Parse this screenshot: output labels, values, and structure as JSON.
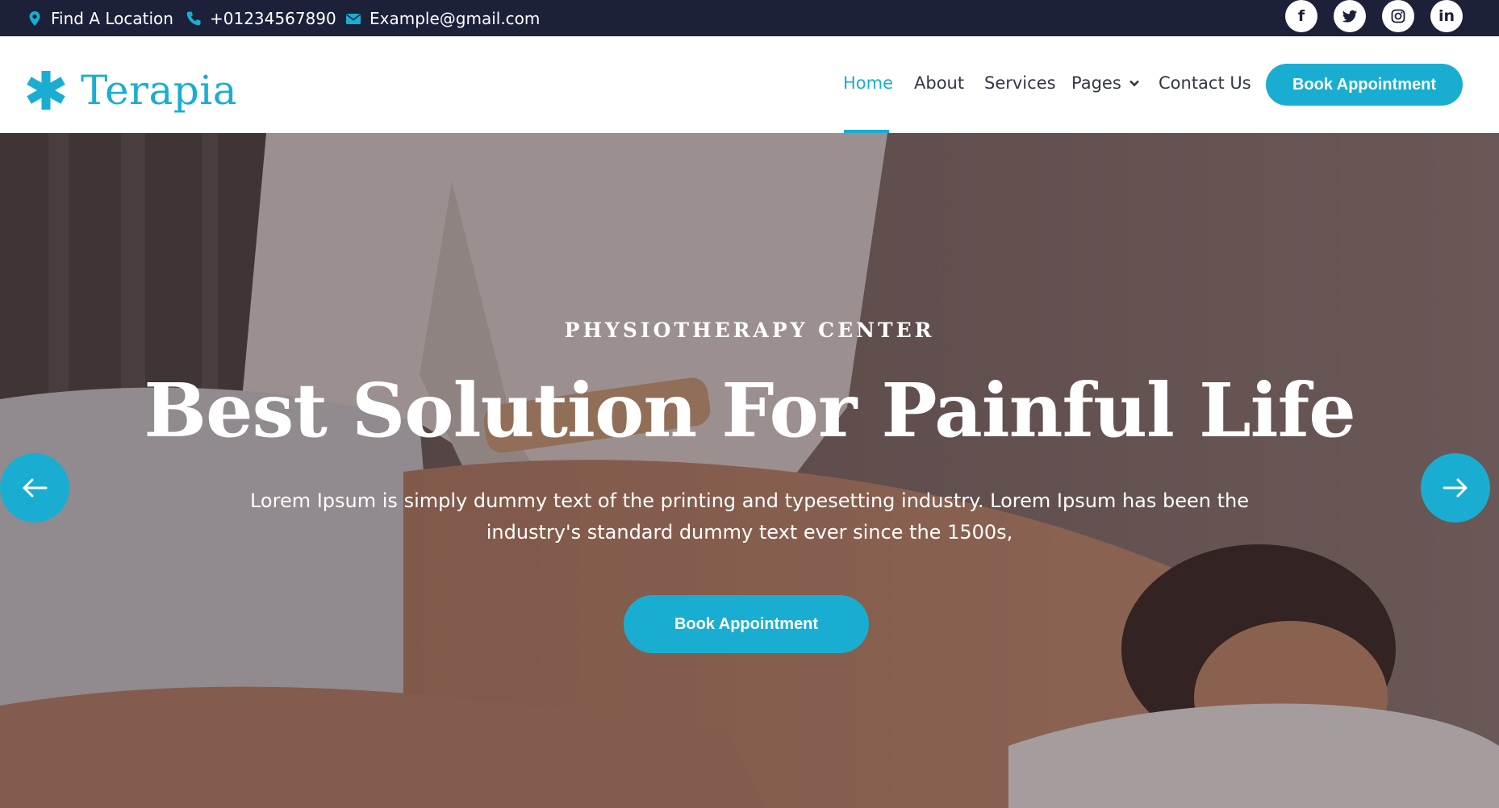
{
  "topbar": {
    "location": "Find A Location",
    "phone": "+01234567890",
    "email": "Example@gmail.com",
    "social": [
      {
        "icon": "facebook-icon",
        "label": "f"
      },
      {
        "icon": "twitter-icon",
        "label": ""
      },
      {
        "icon": "instagram-icon",
        "label": ""
      },
      {
        "icon": "linkedin-icon",
        "label": "in"
      }
    ]
  },
  "header": {
    "brand": "Terapia",
    "nav": {
      "home": "Home",
      "about": "About",
      "services": "Services",
      "pages": "Pages",
      "contact": "Contact Us"
    },
    "cta": "Book Appointment"
  },
  "hero": {
    "kicker": "PHYSIOTHERAPY CENTER",
    "title": "Best Solution For Painful Life",
    "description": "Lorem Ipsum is simply dummy text of the printing and typesetting industry. Lorem Ipsum has been the industry's standard dummy text ever since the 1500s,",
    "cta": "Book Appointment",
    "prev_icon": "arrow-left-icon",
    "next_icon": "arrow-right-icon"
  },
  "colors": {
    "accent": "#19aed1",
    "topbar": "#1c2038",
    "text_dark": "#333745"
  }
}
